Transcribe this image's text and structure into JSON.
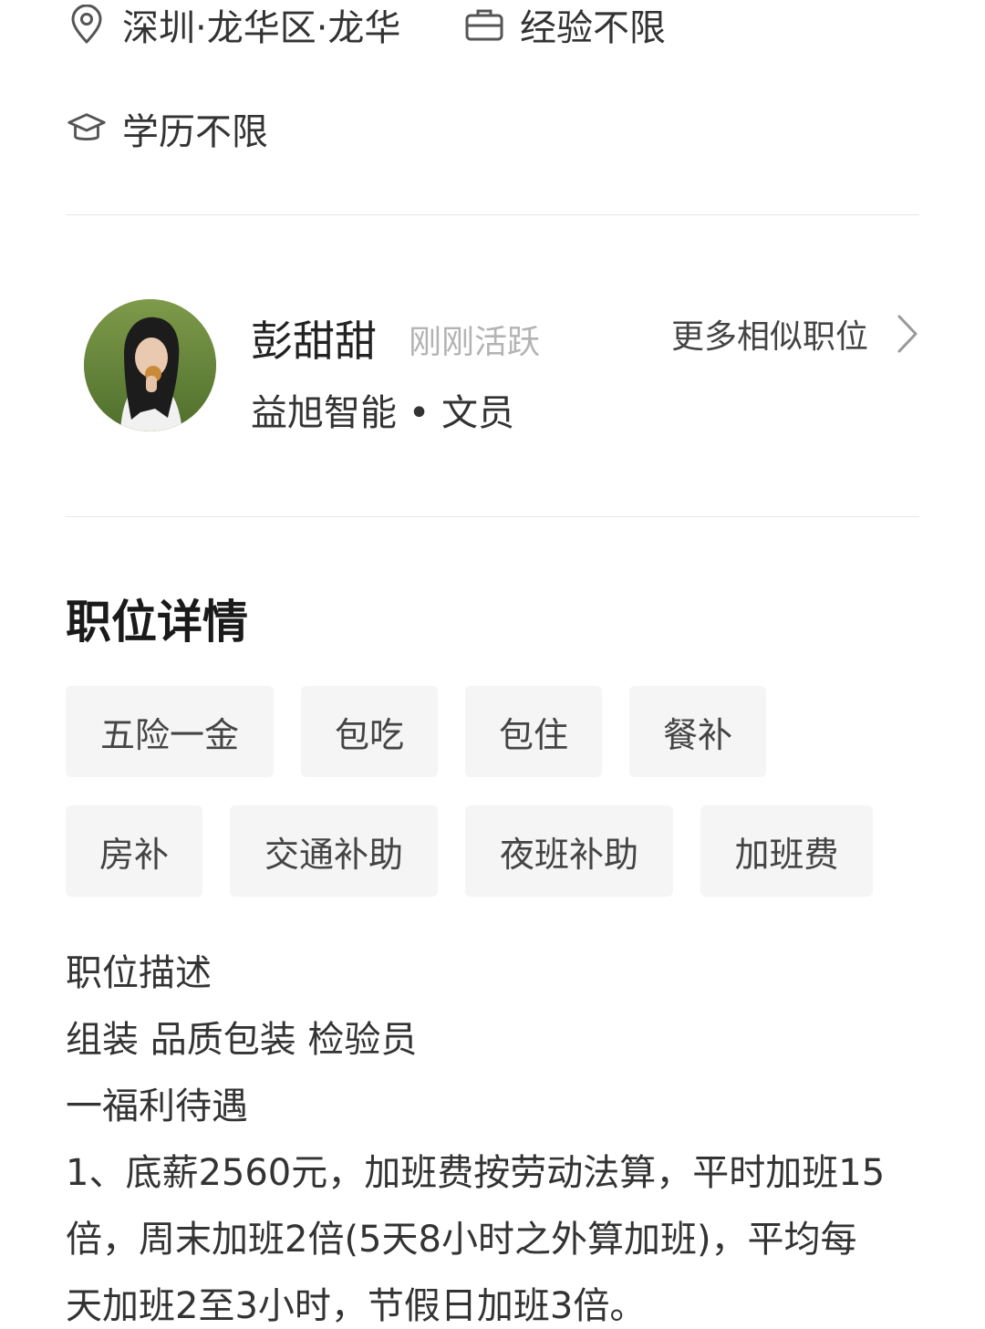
{
  "job_meta": {
    "location": "深圳·龙华区·龙华",
    "experience": "经验不限",
    "education": "学历不限"
  },
  "recruiter": {
    "name": "彭甜甜",
    "status": "刚刚活跃",
    "company_role": "益旭智能 • 文员",
    "more_link": "更多相似职位"
  },
  "details": {
    "title": "职位详情",
    "tags": [
      "五险一金",
      "包吃",
      "包住",
      "餐补",
      "房补",
      "交通补助",
      "夜班补助",
      "加班费"
    ],
    "description": [
      "职位描述",
      "组装 品质包装 检验员",
      "一福利待遇",
      "1、底薪2560元，加班费按劳动法算，平时加班15",
      "倍，周末加班2倍(5天8小时之外算加班)，平均每",
      "天加班2至3小时，节假日加班3倍。"
    ]
  },
  "icons": {
    "location": "map-pin-icon",
    "experience": "briefcase-icon",
    "education": "graduation-cap-icon",
    "more": "chevron-right-icon"
  }
}
